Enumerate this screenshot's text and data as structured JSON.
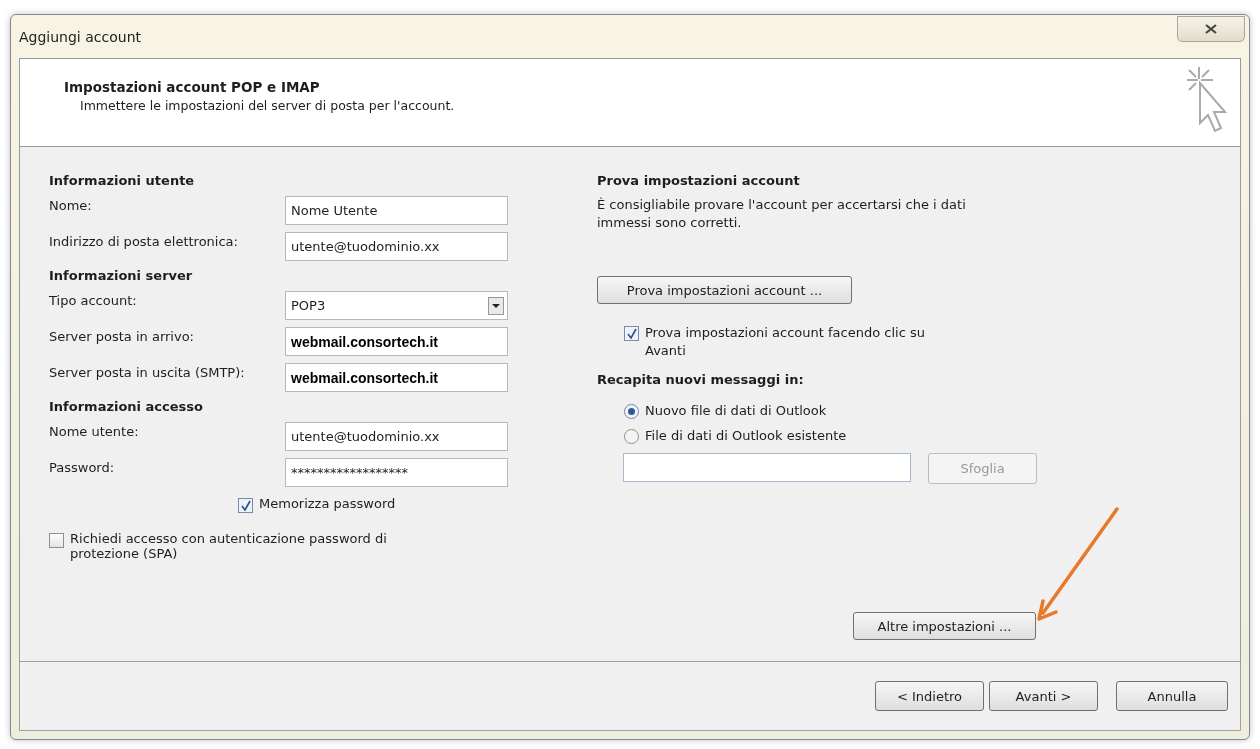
{
  "window": {
    "title": "Aggiungi account"
  },
  "header": {
    "title": "Impostazioni account POP e IMAP",
    "subtitle": "Immettere le impostazioni del server di posta per l'account."
  },
  "left": {
    "sections": [
      {
        "heading": "Informazioni utente",
        "fields": [
          {
            "kind": "text",
            "label": "Nome:",
            "value": "Nome Utente"
          },
          {
            "kind": "text",
            "label": "Indirizzo di posta elettronica:",
            "value": "utente@tuodominio.xx"
          }
        ]
      },
      {
        "heading": "Informazioni server",
        "fields": [
          {
            "kind": "select",
            "label": "Tipo account:",
            "value": "POP3"
          },
          {
            "kind": "text",
            "label": "Server posta in arrivo:",
            "value": "webmail.consortech.it",
            "emphasized": true
          },
          {
            "kind": "text",
            "label": "Server posta in uscita (SMTP):",
            "value": "webmail.consortech.it",
            "emphasized": true
          }
        ]
      },
      {
        "heading": "Informazioni accesso",
        "fields": [
          {
            "kind": "text",
            "label": "Nome utente:",
            "value": "utente@tuodominio.xx"
          },
          {
            "kind": "text",
            "label": "Password:",
            "value": "******************"
          }
        ]
      }
    ],
    "remember_password": {
      "label": "Memorizza password",
      "checked": true
    },
    "spa": {
      "label": "Richiedi accesso con autenticazione password di protezione (SPA)",
      "checked": false
    }
  },
  "right": {
    "heading": "Prova impostazioni account",
    "description": "È consigliabile provare l'account per accertarsi che i dati immessi sono corretti.",
    "test_button": "Prova impostazioni account ...",
    "test_on_next": {
      "label": "Prova impostazioni account facendo clic su Avanti",
      "checked": true
    },
    "deliver_heading": "Recapita nuovi messaggi in:",
    "deliver_options": [
      {
        "label": "Nuovo file di dati di Outlook",
        "selected": true
      },
      {
        "label": "File di dati di Outlook esistente",
        "selected": false
      }
    ],
    "browse_button": {
      "label": "Sfoglia",
      "disabled": true
    },
    "more_settings_button": "Altre impostazioni ..."
  },
  "footer": {
    "buttons": [
      {
        "label": "< Indietro"
      },
      {
        "label": "Avanti >"
      },
      {
        "label": "Annulla"
      }
    ]
  }
}
